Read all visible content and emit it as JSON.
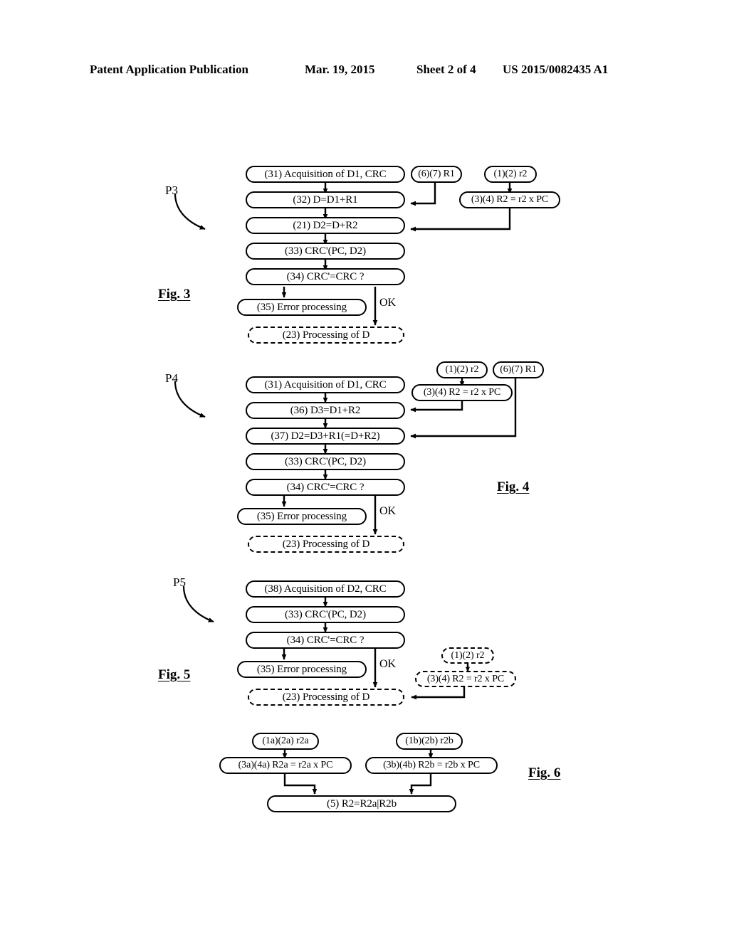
{
  "header": {
    "publication": "Patent Application Publication",
    "date": "Mar. 19, 2015",
    "sheet": "Sheet 2 of 4",
    "number": "US 2015/0082435 A1"
  },
  "figures": [
    {
      "id": "fig3",
      "caption": "Fig. 3",
      "process_label": "P3",
      "nodes": {
        "n31": "(31) Acquisition of D1, CRC",
        "n32": "(32) D=D1+R1",
        "n21": "(21) D2=D+R2",
        "n33": "(33) CRC'(PC, D2)",
        "n34": "(34) CRC'=CRC ?",
        "n35": "(35) Error processing",
        "n23": "(23) Processing of D",
        "r1": "(6)(7) R1",
        "r2": "(1)(2) r2",
        "r2pc": "(3)(4) R2 = r2 x PC"
      },
      "edge_label_ok": "OK"
    },
    {
      "id": "fig4",
      "caption": "Fig. 4",
      "process_label": "P4",
      "nodes": {
        "n31": "(31) Acquisition of D1, CRC",
        "n36": "(36) D3=D1+R2",
        "n37": "(37) D2=D3+R1(=D+R2)",
        "n33": "(33) CRC'(PC, D2)",
        "n34": "(34) CRC'=CRC ?",
        "n35": "(35) Error processing",
        "n23": "(23) Processing of D",
        "r2": "(1)(2) r2",
        "r1": "(6)(7) R1",
        "r2pc": "(3)(4) R2 = r2 x PC"
      },
      "edge_label_ok": "OK"
    },
    {
      "id": "fig5",
      "caption": "Fig. 5",
      "process_label": "P5",
      "nodes": {
        "n38": "(38) Acquisition of D2, CRC",
        "n33": "(33) CRC'(PC, D2)",
        "n34": "(34) CRC'=CRC ?",
        "n35": "(35) Error processing",
        "n23": "(23) Processing of D",
        "r2": "(1)(2) r2",
        "r2pc": "(3)(4) R2 = r2 x PC"
      },
      "edge_label_ok": "OK"
    },
    {
      "id": "fig6",
      "caption": "Fig. 6",
      "nodes": {
        "r2a": "(1a)(2a) r2a",
        "r2b": "(1b)(2b) r2b",
        "r2a_pc": "(3a)(4a) R2a = r2a x PC",
        "r2b_pc": "(3b)(4b) R2b = r2b x PC",
        "merge": "(5) R2=R2a|R2b"
      }
    }
  ],
  "colors": {
    "ink": "#000000",
    "paper": "#ffffff"
  }
}
